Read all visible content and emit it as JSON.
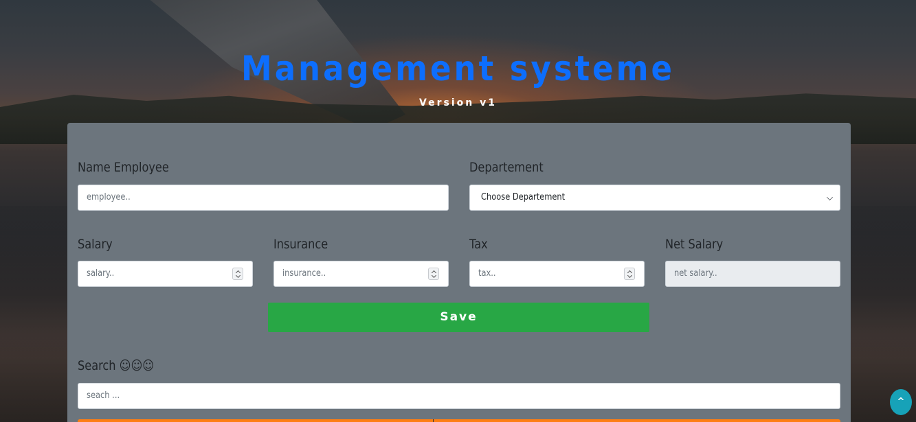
{
  "header": {
    "title": "Management systeme",
    "subtitle": "Version v1"
  },
  "form": {
    "name_label": "Name Employee",
    "name_placeholder": "employee..",
    "department_label": "Departement",
    "department_selected": "Choose Departement",
    "salary_label": "Salary",
    "salary_placeholder": "salary..",
    "insurance_label": "Insurance",
    "insurance_placeholder": "insurance..",
    "tax_label": "Tax",
    "tax_placeholder": "tax..",
    "net_salary_label": "Net Salary",
    "net_salary_placeholder": "net salary..",
    "save_label": "Save"
  },
  "search": {
    "label": "Search ☺☺☺",
    "placeholder": "seach ..."
  },
  "scroll_top": {
    "label": "^"
  },
  "colors": {
    "title": "#0d6efd",
    "panel": "#6c757d",
    "save_button": "#28a745",
    "scroll_top_button": "#17a2b8",
    "table_header_strip": "#fd7e14"
  }
}
